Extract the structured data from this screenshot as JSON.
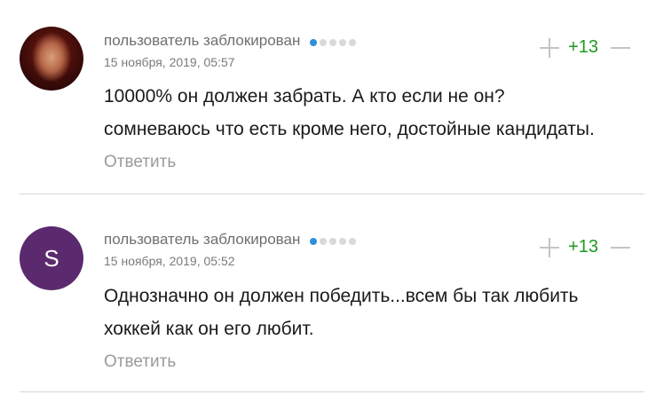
{
  "comments": [
    {
      "author": "пользователь заблокирован",
      "date": "15 ноября, 2019, 05:57",
      "lines": [
        "10000% он должен забрать. А кто если не он?",
        "сомневаюсь что есть кроме него, достойные кандидаты."
      ],
      "reply_label": "Ответить",
      "score": "+13",
      "rank_dots": 5,
      "rank_level": 1
    },
    {
      "avatar_letter": "S",
      "author": "пользователь заблокирован",
      "date": "15 ноября, 2019, 05:52",
      "lines": [
        "Однозначно он должен победить...всем бы так любить",
        "хоккей как он его любит."
      ],
      "reply_label": "Ответить",
      "score": "+13",
      "rank_dots": 5,
      "rank_level": 1
    }
  ],
  "colors": {
    "score_positive": "#1d9a1d",
    "rank_dot_active": "#2f8fd8",
    "avatar_letter_bg": "#5b2a6e"
  }
}
